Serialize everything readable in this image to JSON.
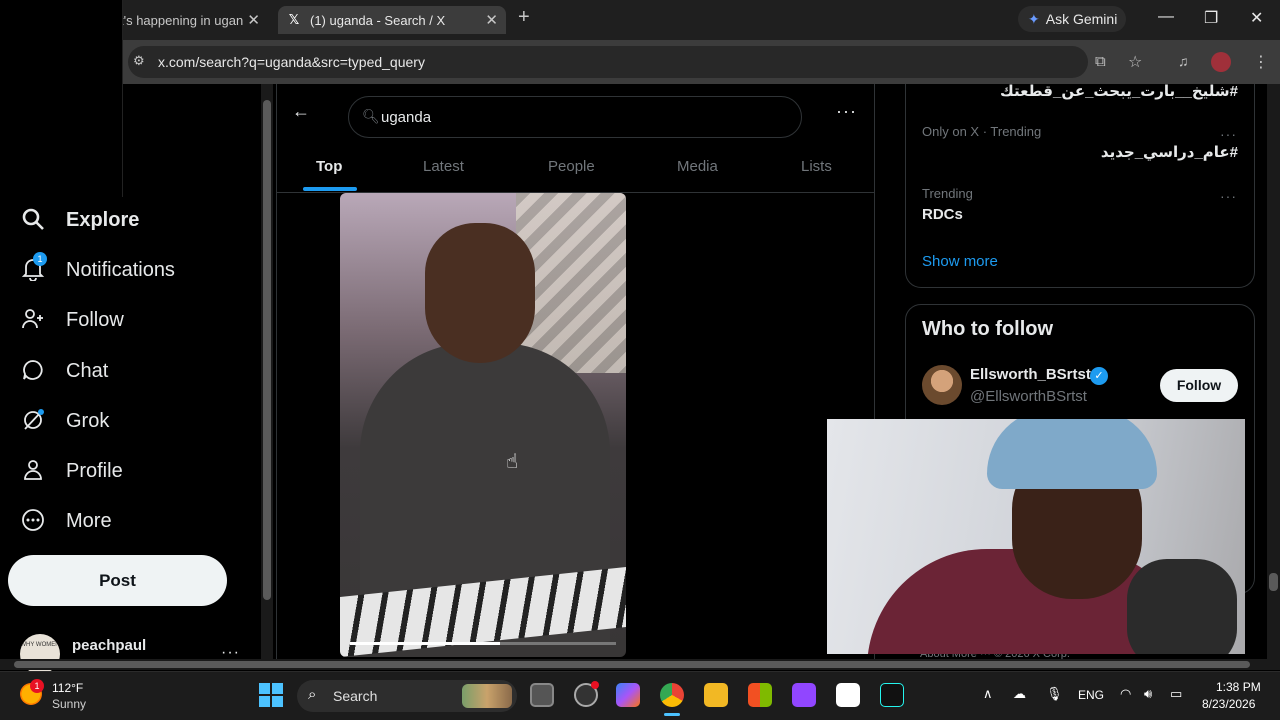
{
  "browser": {
    "tabs": [
      {
        "title": "t's happening in ugan"
      },
      {
        "title": "(1) uganda - Search / X",
        "active": true
      }
    ],
    "ask_gemini": "Ask Gemini",
    "url": "x.com/search?q=uganda&src=typed_query"
  },
  "sidebar": {
    "items": [
      {
        "label": "Explore",
        "icon": "search-icon"
      },
      {
        "label": "Notifications",
        "icon": "bell-icon",
        "badge": "1"
      },
      {
        "label": "Follow",
        "icon": "person-add-icon"
      },
      {
        "label": "Chat",
        "icon": "chat-icon"
      },
      {
        "label": "Grok",
        "icon": "grok-icon"
      },
      {
        "label": "Profile",
        "icon": "person-icon"
      },
      {
        "label": "More",
        "icon": "more-circle-icon"
      }
    ],
    "post_label": "Post",
    "account": {
      "name": "peachpaul",
      "avatar_text": "WHY WOMEN"
    }
  },
  "search": {
    "query": "uganda",
    "tabs": [
      "Top",
      "Latest",
      "People",
      "Media",
      "Lists"
    ],
    "active_tab": "Top"
  },
  "trends": {
    "top_partial": "#شليخ__بارت_يبحث_عن_قطعتك",
    "items": [
      {
        "context": "Only on X · Trending",
        "name": "#عام_دراسي_جديد"
      },
      {
        "context": "Trending",
        "name": "RDCs"
      }
    ],
    "show_more": "Show more"
  },
  "who_to_follow": {
    "title": "Who to follow",
    "name": "Ellsworth_BSrtst",
    "handle": "@EllsworthBSrtst",
    "follow_label": "Follow"
  },
  "footer_partial": "About   More ···   © 2026 X Corp.",
  "taskbar": {
    "weather_temp": "112°F",
    "weather_cond": "Sunny",
    "weather_badge": "1",
    "search_label": "Search",
    "lang": "ENG",
    "time": "1:38 PM",
    "date": "8/23/2026"
  },
  "colors": {
    "accent": "#1d9bf0",
    "background": "#000000",
    "text": "#e7e9ea",
    "muted": "#71767b"
  }
}
